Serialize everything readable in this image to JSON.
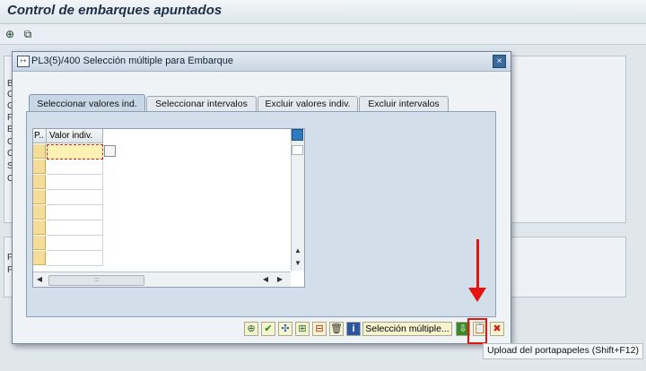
{
  "app": {
    "title": "Control de embarques apuntados",
    "toolbar_icons": [
      "execute-icon",
      "copy-icon"
    ]
  },
  "background_labels": [
    "B",
    "C",
    "G",
    "F",
    "E",
    "C",
    "C",
    "S",
    "C",
    "F",
    "F"
  ],
  "dialog": {
    "title": "PL3(5)/400 Selección múltiple para Embarque",
    "close_label": "×",
    "tabs": [
      {
        "label": "Seleccionar valores ind.",
        "active": true
      },
      {
        "label": "Seleccionar intervalos",
        "active": false
      },
      {
        "label": "Excluir valores indiv.",
        "active": false
      },
      {
        "label": "Excluir intervalos",
        "active": false
      }
    ],
    "grid": {
      "col_p": "P..",
      "col_value": "Valor indiv.",
      "rows": 8
    },
    "footer": {
      "buttons": [
        {
          "name": "execute-icon",
          "glyph": "⊕",
          "color": "#2c6a2c"
        },
        {
          "name": "checkmark-icon",
          "glyph": "✔",
          "color": "#1c8a1c"
        },
        {
          "name": "insert-line-icon",
          "glyph": "✣",
          "color": "#1a5fa8"
        },
        {
          "name": "add-row-icon",
          "glyph": "⊞",
          "color": "#2c6a2c"
        },
        {
          "name": "delete-row-icon",
          "glyph": "⊟",
          "color": "#b02020"
        },
        {
          "name": "delete-all-icon",
          "glyph": "🗑",
          "color": "#333333"
        },
        {
          "name": "info-icon",
          "glyph": "i",
          "color": "#1a3f8f"
        }
      ],
      "multiple_selection_label": "Selección múltiple...",
      "import_button": {
        "name": "import-icon",
        "glyph": "⇩",
        "color": "#1c8a1c"
      },
      "clipboard_button": {
        "name": "clipboard-upload-icon",
        "glyph": "📋",
        "color": "#4a4a4a"
      },
      "cancel_button": {
        "name": "cancel-icon",
        "glyph": "✖",
        "color": "#d01c1c"
      }
    }
  },
  "tooltip": "Upload del portapapeles    (Shift+F12)",
  "accent": "#e8130f"
}
